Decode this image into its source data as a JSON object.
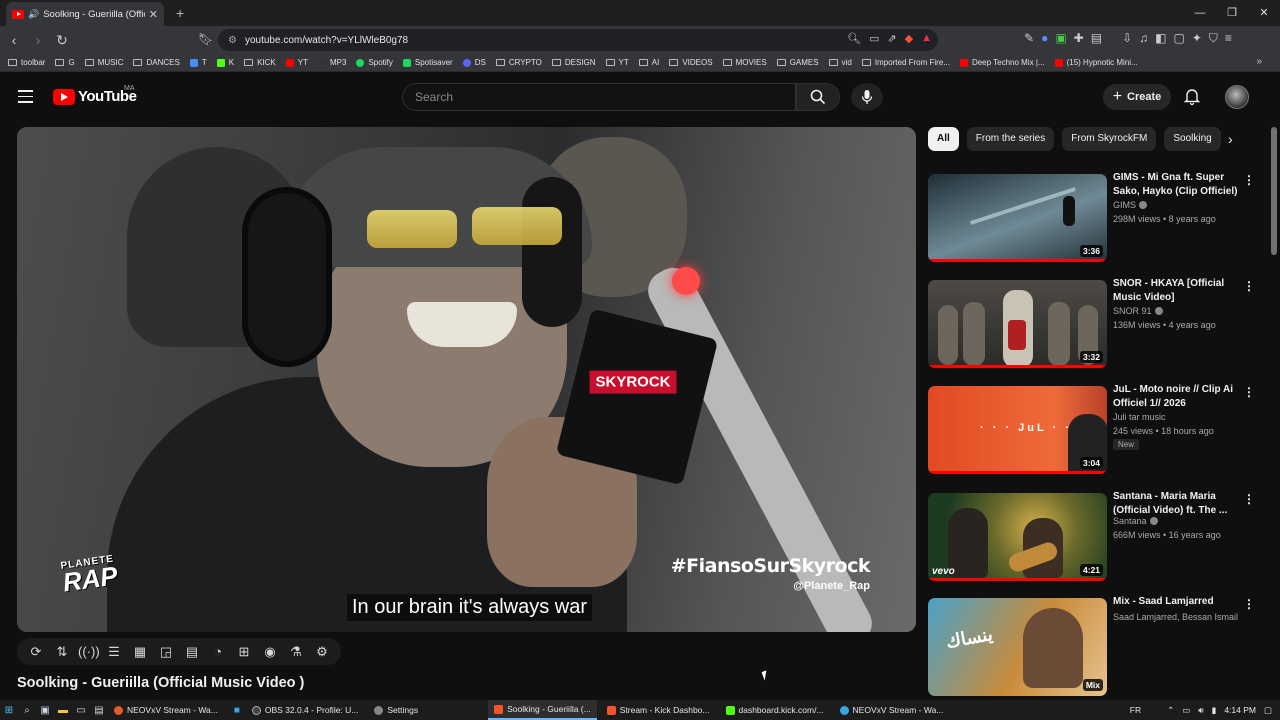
{
  "browser": {
    "tab_title": "Soolking - Gueriilla (Official M",
    "url": "youtube.com/watch?v=YLlWleB0g78",
    "bookmarks": [
      "toolbar",
      "G",
      "MUSIC",
      "DANCES",
      "T",
      "K",
      "KICK",
      "YT",
      "MP3",
      "Spotify",
      "Spotisaver",
      "DS",
      "CRYPTO",
      "DESIGN",
      "YT",
      "AI",
      "VIDEOS",
      "MOVIES",
      "GAMES",
      "vid",
      "Imported From Fire...",
      "Deep Techno Mix |...",
      "(15) Hypnotic Mini..."
    ]
  },
  "youtube": {
    "logo_text": "YouTube",
    "logo_country": "MA",
    "search_placeholder": "Search",
    "create_label": "Create"
  },
  "player": {
    "subtitle": "In our brain it's always war",
    "overlay_hashtag": "#FiansoSurSkyrock",
    "overlay_handle": "@Planete_Rap",
    "overlay_logo_top": "PLANETE",
    "overlay_logo_bottom": "RAP",
    "mic_brand": "SKYROCK"
  },
  "video_title": "Soolking - Gueriilla (Official Music Video )",
  "chips": [
    "All",
    "From the series",
    "From SkyrockFM",
    "Soolking"
  ],
  "recommendations": [
    {
      "title": "GIMS - Mi Gna ft. Super Sako, Hayko (Clip Officiel)",
      "channel": "GIMS",
      "meta": "298M views • 8 years ago",
      "duration": "3:36",
      "badge": "",
      "progress": 1.0,
      "colors": [
        "#1f2e36",
        "#6f8a95"
      ]
    },
    {
      "title": "SNOR - HKAYA [Official Music Video]",
      "channel": "SNOR 91",
      "meta": "136M views • 4 years ago",
      "duration": "3:32",
      "badge": "",
      "progress": 1.0,
      "colors": [
        "#2b2a28",
        "#8a8378"
      ]
    },
    {
      "title": "JuL - Moto noire // Clip Ai Officiel 1// 2026",
      "channel": "Juli tar music",
      "meta": "245 views • 18 hours ago",
      "duration": "3:04",
      "badge": "New",
      "progress": 1.0,
      "colors": [
        "#e04a22",
        "#f06a3a"
      ]
    },
    {
      "title": "Santana - Maria Maria (Official Video) ft. The ...",
      "channel": "Santana",
      "meta": "666M views • 16 years ago",
      "duration": "4:21",
      "badge": "",
      "progress": 1.0,
      "colors": [
        "#1c3a20",
        "#b89a3c"
      ]
    },
    {
      "title": "Mix - Saad Lamjarred",
      "channel": "Saad Lamjarred, Bessan Ismail, H...",
      "meta": "",
      "duration": "Mix",
      "badge": "",
      "progress": 0,
      "colors": [
        "#c98b3a",
        "#4aa2c8"
      ]
    }
  ],
  "taskbar": {
    "items": [
      {
        "label": "NEOVxV Stream - Wa...",
        "color": "#e25b2b"
      },
      {
        "label": "OBS 32.0.4 - Profile: U...",
        "color": "#444"
      },
      {
        "label": "Settings",
        "color": "#888"
      },
      {
        "label": "Soolking - Gueriilla (...",
        "color": "#ff0000"
      },
      {
        "label": "Stream - Kick Dashbo...",
        "color": "#d23"
      },
      {
        "label": "dashboard.kick.com/...",
        "color": "#53fc18"
      },
      {
        "label": "NEOVxV Stream - Wa...",
        "color": "#3aa5e0"
      }
    ],
    "language": "FR",
    "time": "4:14 PM"
  }
}
